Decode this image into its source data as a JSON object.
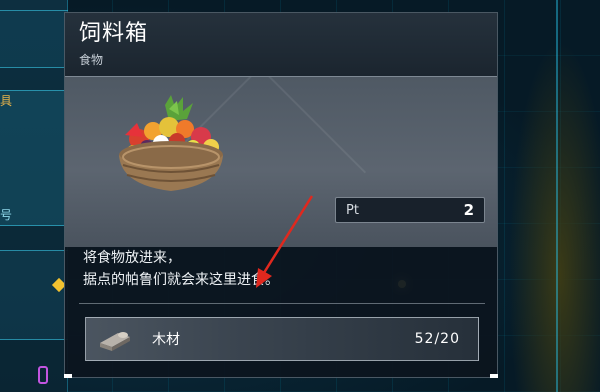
{
  "item": {
    "title": "饲料箱",
    "category": "食物",
    "pt_label": "Pt",
    "pt_value": "2",
    "description": [
      "将食物放进来，",
      "据点的帕鲁们就会来这里进食。"
    ]
  },
  "materials": [
    {
      "icon": "wood-icon",
      "name": "木材",
      "count": "52/20"
    }
  ],
  "background": {
    "left_glyphs": [
      "具",
      "号"
    ]
  },
  "colors": {
    "accent_cyan": "#28c8f0",
    "panel_bg": "#0c141e",
    "annotation_arrow": "#e0281e"
  }
}
